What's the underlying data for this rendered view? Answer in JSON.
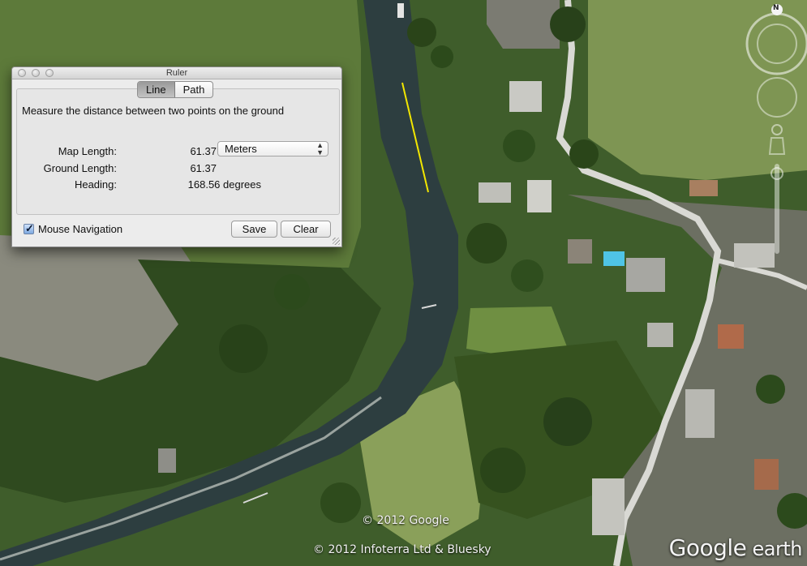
{
  "window": {
    "title": "Ruler",
    "tabs": [
      {
        "label": "Line",
        "active": true
      },
      {
        "label": "Path",
        "active": false
      }
    ],
    "description": "Measure the distance between two points on the ground",
    "fields": {
      "map_length": {
        "label": "Map Length:",
        "value": "61.37"
      },
      "ground_length": {
        "label": "Ground Length:",
        "value": "61.37"
      },
      "heading": {
        "label": "Heading:",
        "value": "168.56 degrees"
      }
    },
    "units": {
      "selected": "Meters"
    },
    "mouse_navigation": {
      "label": "Mouse Navigation",
      "checked": true
    },
    "buttons": {
      "save": "Save",
      "clear": "Clear"
    }
  },
  "map": {
    "credits": [
      "© 2012 Google",
      "© 2012 Infoterra Ltd & Bluesky"
    ],
    "brand": {
      "part1": "Google",
      "part2": " earth"
    },
    "compass_label": "N",
    "measure_line_color": "#f2e600"
  },
  "colors": {
    "window_bg": "#ececec",
    "accent": "#4a82d6",
    "water": "#2c3c3e"
  }
}
